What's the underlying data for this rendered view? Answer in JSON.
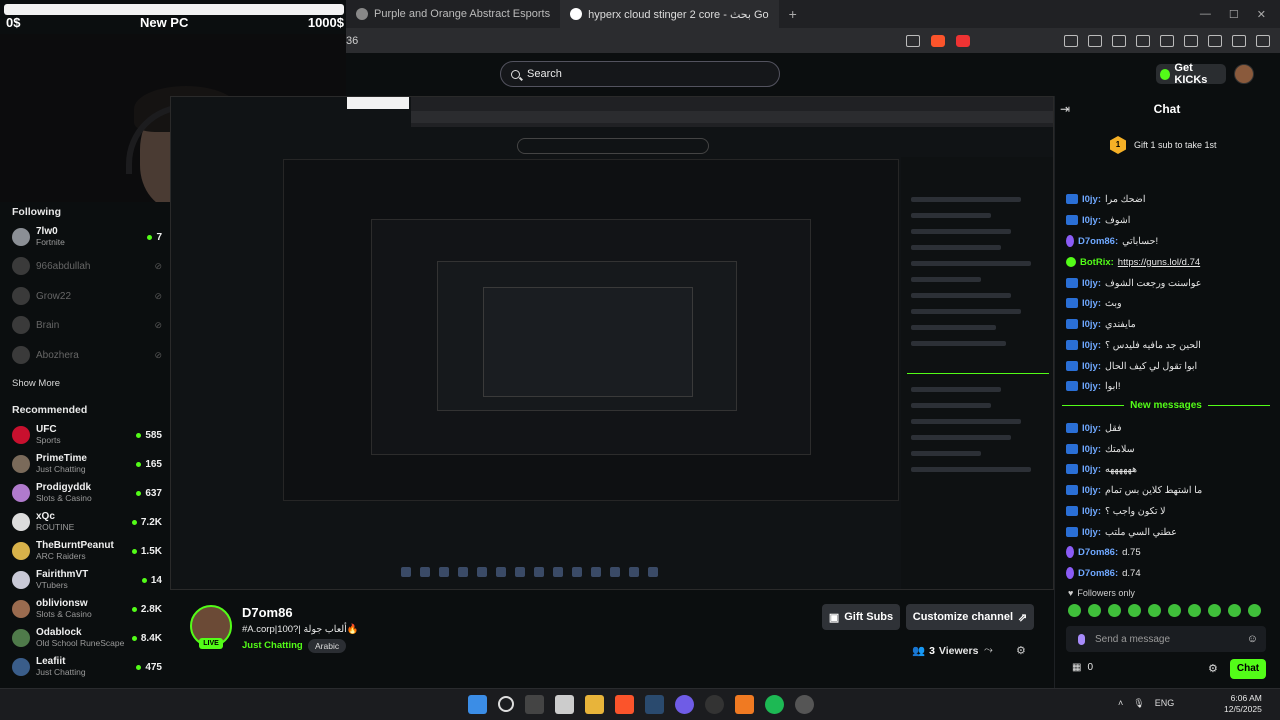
{
  "ticker": {
    "left": "0$",
    "center": "New PC",
    "right": "1000$"
  },
  "browser": {
    "tabs": [
      {
        "label": "Purple and Orange Abstract Esports"
      },
      {
        "label": "hyperx cloud stinger 2 core - بحث Go"
      }
    ],
    "new_tab": "+",
    "url": "36"
  },
  "header": {
    "search_placeholder": "Search",
    "get_kicks": "Get KICKs"
  },
  "sidebar": {
    "following_heading": "Following",
    "following": [
      {
        "name": "7lw0",
        "sub": "Fortnite",
        "count": "7",
        "live": true
      },
      {
        "name": "966abdullah",
        "sub": "",
        "count": "",
        "live": false
      },
      {
        "name": "Grow22",
        "sub": "",
        "count": "",
        "live": false
      },
      {
        "name": "Brain",
        "sub": "",
        "count": "",
        "live": false
      },
      {
        "name": "Abozhera",
        "sub": "",
        "count": "",
        "live": false
      }
    ],
    "show_more": "Show More",
    "recommended_heading": "Recommended",
    "recommended": [
      {
        "name": "UFC",
        "sub": "Sports",
        "count": "585"
      },
      {
        "name": "PrimeTime",
        "sub": "Just Chatting",
        "count": "165"
      },
      {
        "name": "Prodigyddk",
        "sub": "Slots & Casino",
        "count": "637"
      },
      {
        "name": "xQc",
        "sub": "ROUTINE",
        "count": "7.2K"
      },
      {
        "name": "TheBurntPeanut",
        "sub": "ARC Raiders",
        "count": "1.5K"
      },
      {
        "name": "FairithmVT",
        "sub": "VTubers",
        "count": "14"
      },
      {
        "name": "oblivionsw",
        "sub": "Slots & Casino",
        "count": "2.8K"
      },
      {
        "name": "Odablock",
        "sub": "Old School RuneScape",
        "count": "8.4K"
      },
      {
        "name": "Leafiit",
        "sub": "Just Chatting",
        "count": "475"
      }
    ]
  },
  "stream": {
    "live_badge": "LIVE",
    "channel_name": "D7om86",
    "title": "#A.corp|100?| ألعاب جولة🔥",
    "category": "Just Chatting",
    "language": "Arabic",
    "gift_subs": "Gift Subs",
    "customize": "Customize channel",
    "viewers_count": "3",
    "viewers_label": "Viewers"
  },
  "chat": {
    "title": "Chat",
    "pinned": "Gift 1 sub to take 1st",
    "pinned_badge": "1",
    "messages": [
      {
        "user": "I0jy:",
        "text": "اضحك مرا",
        "type": "user"
      },
      {
        "user": "I0jy:",
        "text": "اشوف",
        "type": "user"
      },
      {
        "user": "D7om86:",
        "text": "حساباتي!",
        "type": "mod"
      },
      {
        "user": "BotRix:",
        "text": "https://guns.lol/d.74",
        "type": "bot"
      },
      {
        "user": "I0jy:",
        "text": "عواسنت ورجعت الشوف",
        "type": "user"
      },
      {
        "user": "I0jy:",
        "text": "وبث",
        "type": "user"
      },
      {
        "user": "I0jy:",
        "text": "مايفندي",
        "type": "user"
      },
      {
        "user": "I0jy:",
        "text": "الحين جد مافيه فليدس ؟",
        "type": "user"
      },
      {
        "user": "I0jy:",
        "text": "ابوا تقول لي كيف الحال",
        "type": "user"
      },
      {
        "user": "I0jy:",
        "text": "ابوا!",
        "type": "user"
      }
    ],
    "new_messages": "New messages",
    "new": [
      {
        "user": "I0jy:",
        "text": "فقل",
        "type": "user"
      },
      {
        "user": "I0jy:",
        "text": "سلامتك",
        "type": "user"
      },
      {
        "user": "I0jy:",
        "text": "ههههههه",
        "type": "user"
      },
      {
        "user": "I0jy:",
        "text": "ما اشتهط كلاين بس تمام",
        "type": "user"
      },
      {
        "user": "I0jy:",
        "text": "لا تكون واجب ؟",
        "type": "user"
      },
      {
        "user": "I0jy:",
        "text": "عطني السي ملتب",
        "type": "user"
      },
      {
        "user": "D7om86:",
        "text": "d.75",
        "type": "mod"
      },
      {
        "user": "D7om86:",
        "text": "d.74",
        "type": "mod"
      }
    ],
    "followers_only": "Followers only",
    "input_placeholder": "Send a message",
    "points": "0",
    "send_label": "Chat"
  },
  "taskbar": {
    "lang": "ENG",
    "time": "6:06 AM",
    "date": "12/5/2025"
  },
  "colors": {
    "accent": "#53fc18",
    "background": "#0b0e0f"
  }
}
